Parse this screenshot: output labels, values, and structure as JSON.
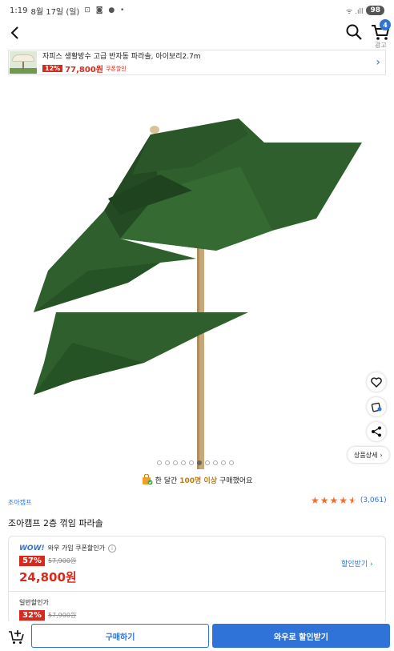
{
  "status_bar": {
    "time": "1:19",
    "date": "8월 17일 (일)",
    "notif_icons": "⊡ ◙ ● •",
    "signal": "ᯤ .ıll",
    "battery": "98"
  },
  "header": {
    "cart_count": "4",
    "ad_label": "광고"
  },
  "ad_banner": {
    "title": "자피스 생활방수 고급 반자동 파라솔, 아이보리2.7m",
    "discount": "12%",
    "price": "77,800원",
    "coupon_text": "쿠폰할인"
  },
  "gallery": {
    "total_images": 10,
    "active_index": 5,
    "detail_button": "상품상세",
    "colors": {
      "canopy": "#2f5f2d",
      "canopy_dark": "#234a22",
      "pole": "#c9a877"
    }
  },
  "purchase_notice": {
    "prefix": "한 달간",
    "highlight": "100명 이상",
    "suffix": "구매했어요"
  },
  "product": {
    "brand": "조아캠프",
    "rating_stars": 4.5,
    "rating_count": "(3,061)",
    "title": "조아캠프 2층 꺾임 파라솔"
  },
  "pricing": {
    "wow_logo": "WOW!",
    "wow_label": "와우 가입 쿠폰할인가",
    "wow_discount": "57%",
    "wow_original": "57,900원",
    "wow_price": "24,800원",
    "coupon_link": "할인받기",
    "general_label": "일반할인가",
    "general_discount": "32%",
    "general_original": "57,900원"
  },
  "bottom_bar": {
    "buy_label": "구매하기",
    "wow_label": "와우로 할인받기"
  },
  "colors": {
    "accent": "#2f73d9",
    "sale_red": "#d62a1e",
    "star": "#f26c2b"
  }
}
